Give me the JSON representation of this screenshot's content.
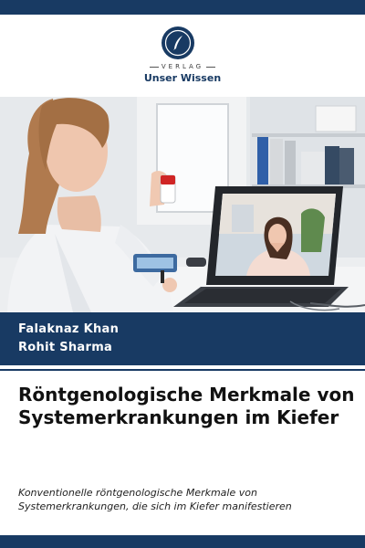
{
  "publisher": {
    "label": "VERLAG",
    "name": "Unser Wissen"
  },
  "authors": [
    "Falaknaz Khan",
    "Rohit Sharma"
  ],
  "book": {
    "title": "Röntgenologische Merkmale von Systemerkrankungen im Kiefer",
    "subtitle": "Konventionelle röntgenologische Merkmale von Systemerkrankungen, die sich im Kiefer manifestieren"
  },
  "colors": {
    "brand_navy": "#183a63"
  }
}
